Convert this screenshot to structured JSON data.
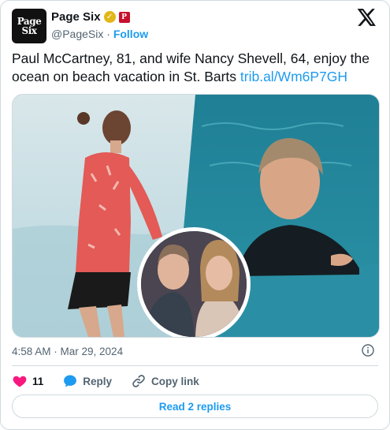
{
  "author": {
    "avatar_text_line1": "Page",
    "avatar_text_line2": "Six",
    "name": "Page Six",
    "handle": "@PageSix",
    "separator": "·",
    "follow_label": "Follow",
    "verified_icon": "gold-verified-badge-icon",
    "affiliate_icon": "red-affiliate-badge-icon"
  },
  "tweet": {
    "text": "Paul McCartney, 81, and wife Nancy Shevell, 64, enjoy the ocean on beach vacation in St. Barts ",
    "link": "trib.al/Wm6P7GH",
    "timestamp": "4:58 AM · Mar 29, 2024"
  },
  "actions": {
    "like_count": "11",
    "reply_label": "Reply",
    "copy_label": "Copy link",
    "read_replies_label": "Read 2 replies"
  },
  "colors": {
    "accent": "#1d9bf0",
    "like": "#f91880",
    "muted": "#536471",
    "border": "#cfd9de"
  }
}
